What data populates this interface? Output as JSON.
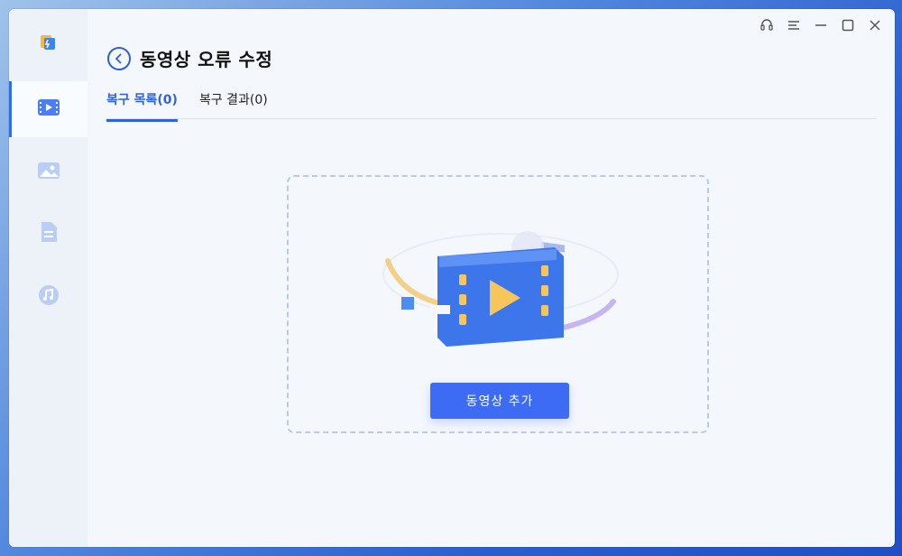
{
  "header": {
    "title": "동영상 오류 수정"
  },
  "tabs": [
    {
      "label": "복구 목록(0)",
      "active": true
    },
    {
      "label": "복구 결과(0)",
      "active": false
    }
  ],
  "drop_zone": {
    "add_button_label": "동영상 추가"
  },
  "sidebar": {
    "items": [
      {
        "icon": "video-icon",
        "active": true
      },
      {
        "icon": "image-icon",
        "active": false
      },
      {
        "icon": "document-icon",
        "active": false
      },
      {
        "icon": "music-icon",
        "active": false
      }
    ]
  },
  "window_controls": [
    "headset-icon",
    "menu-icon",
    "minimize-icon",
    "maximize-icon",
    "close-icon"
  ],
  "colors": {
    "accent": "#2f62e3",
    "button": "#3d6bf4",
    "background": "#f4f7fc",
    "sidebar": "#edf2f9"
  }
}
